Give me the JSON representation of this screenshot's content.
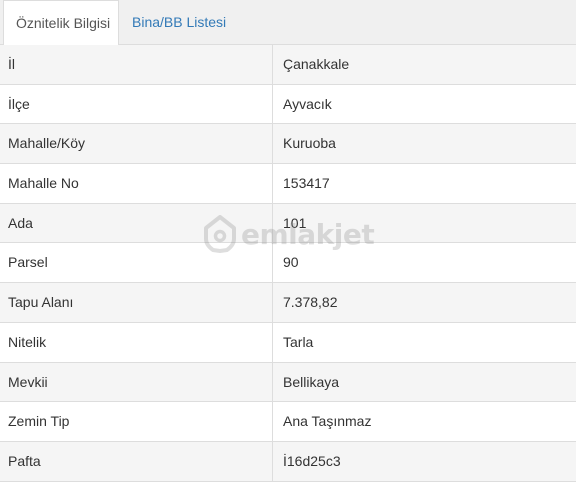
{
  "tabs": [
    {
      "label": "Öznitelik Bilgisi",
      "active": true
    },
    {
      "label": "Bina/BB Listesi",
      "active": false
    }
  ],
  "rows": [
    {
      "label": "İl",
      "value": "Çanakkale"
    },
    {
      "label": "İlçe",
      "value": "Ayvacık"
    },
    {
      "label": "Mahalle/Köy",
      "value": "Kuruoba"
    },
    {
      "label": "Mahalle No",
      "value": "153417"
    },
    {
      "label": "Ada",
      "value": "101"
    },
    {
      "label": "Parsel",
      "value": "90"
    },
    {
      "label": "Tapu Alanı",
      "value": "7.378,82"
    },
    {
      "label": "Nitelik",
      "value": "Tarla"
    },
    {
      "label": "Mevkii",
      "value": "Bellikaya"
    },
    {
      "label": "Zemin Tip",
      "value": "Ana Taşınmaz"
    },
    {
      "label": "Pafta",
      "value": "İ16d25c3"
    }
  ],
  "watermark": {
    "text": "emlakjet",
    "icon": "house-pin-icon"
  },
  "colors": {
    "link": "#337ab7",
    "border": "#dddddd",
    "stripe": "#f5f5f5"
  }
}
